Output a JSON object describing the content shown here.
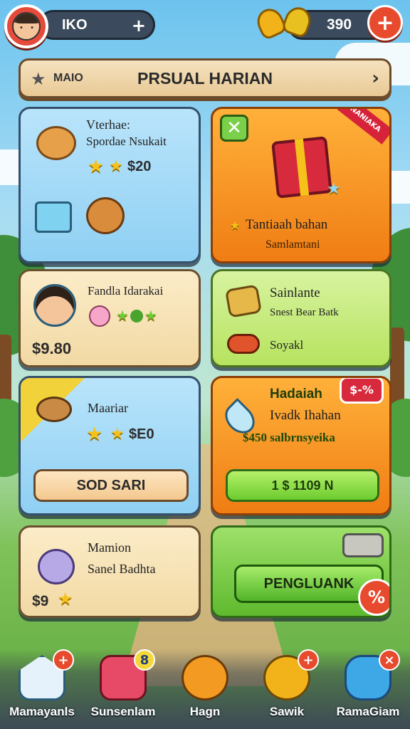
{
  "header": {
    "player_name": "IKO",
    "name_plus": "+",
    "coins": "390",
    "coin_plus": "+"
  },
  "banner": {
    "left_label": "MAIO",
    "title": "PRSUAL HARIAN",
    "arrow": "›"
  },
  "cards": {
    "c1": {
      "title": "Vterhae:",
      "subtitle": "Spordae Nsukait",
      "price": "$20"
    },
    "c2": {
      "ribbon": "NANIAKA",
      "title": "Tantiaah bahan",
      "subtitle": "Samlamtani"
    },
    "c3": {
      "title": "Fandla Idarakai",
      "price": "$9.80"
    },
    "c4": {
      "title": "Sainlante",
      "subtitle": "Snest Bear Batk",
      "extra": "Soyakl"
    },
    "c5": {
      "title": "Maariar",
      "price": "$E0",
      "button": "SOD SARI"
    },
    "c6": {
      "badge": "$-%",
      "title": "Hadaiah",
      "subtitle": "Ivadk Ihahan",
      "offer": "$450 salbrnsyeika",
      "button": "1 $ 1109 N"
    },
    "c7": {
      "title": "Mamion",
      "subtitle": "Sanel Badhta",
      "price": "$9"
    },
    "c8": {
      "button": "PENGLUANK",
      "badge": "%"
    }
  },
  "bottom_nav": [
    {
      "label": "Mamayanls",
      "badge": "+",
      "icon": "house-icon"
    },
    {
      "label": "Sunsenlam",
      "badge": "8",
      "icon": "pig-chest-icon"
    },
    {
      "label": "Hagn",
      "badge": "",
      "icon": "box-icon"
    },
    {
      "label": "Sawik",
      "badge": "+",
      "icon": "capybara-icon"
    },
    {
      "label": "RamaGiam",
      "badge": "×",
      "icon": "cannon-icon"
    }
  ],
  "colors": {
    "accent_red": "#e84a2e",
    "card_blue": "#8fd0f3",
    "card_orange": "#f07d14",
    "card_green": "#5fba2e"
  }
}
